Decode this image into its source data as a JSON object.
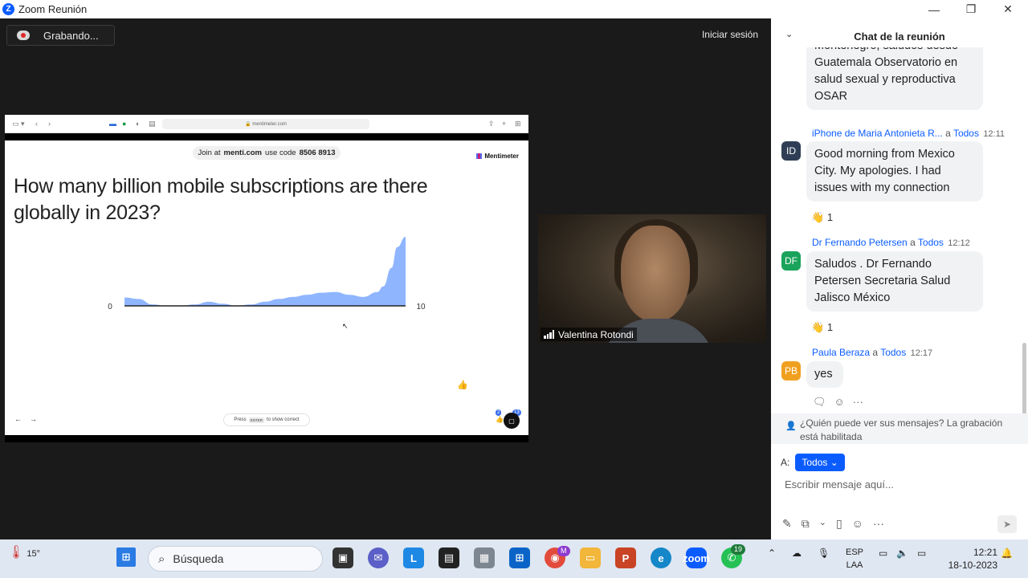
{
  "window": {
    "title": "Zoom Reunión",
    "logo_letter": "Z",
    "minimize_icon": "—",
    "maximize_icon": "❐",
    "close_icon": "✕"
  },
  "meeting": {
    "recording_label": "Grabando...",
    "signin_label": "Iniciar sesión"
  },
  "browser": {
    "url": "mentimeter.com"
  },
  "slide": {
    "join_prefix": "Join at",
    "join_site": "menti.com",
    "join_code_label": "use code",
    "join_code": "8506 8913",
    "brand": "Mentimeter",
    "question": "How many billion mobile subscriptions are there globally in 2023?",
    "press_text_before": "Press",
    "press_key": "ENTER",
    "press_text_after": "to show correct",
    "counter_badge_1": "2",
    "counter_badge_2": "13"
  },
  "chart_data": {
    "type": "area",
    "x_min_label": "0",
    "x_max_label": "10",
    "xlim": [
      0,
      10
    ],
    "x": [
      0,
      0.5,
      1,
      1.5,
      2,
      2.5,
      3,
      3.5,
      4,
      4.5,
      5,
      5.5,
      6,
      6.5,
      7,
      7.5,
      8,
      8.5,
      9,
      9.2,
      9.5,
      9.7,
      10
    ],
    "y": [
      0.12,
      0.1,
      0.02,
      0,
      0,
      0.02,
      0.06,
      0.03,
      0,
      0.02,
      0.06,
      0.1,
      0.13,
      0.16,
      0.19,
      0.2,
      0.16,
      0.13,
      0.2,
      0.28,
      0.55,
      0.85,
      1.0
    ]
  },
  "video": {
    "participant_name": "Valentina Rotondi"
  },
  "chat": {
    "title": "Chat de la reunión",
    "messages": [
      {
        "partial": true,
        "text": "Montenegro, saludos desde Guatemala Observatorio en salud sexual y reproductiva OSAR"
      },
      {
        "sender": "iPhone de Maria Antonieta R...",
        "to_word": "a",
        "to": "Todos",
        "time": "12:11",
        "initials": "ID",
        "avatar_color": "#2f3e55",
        "text": "Good morning from Mexico City. My apologies. I had issues with my connection",
        "reaction_emoji": "👋",
        "reaction_count": "1"
      },
      {
        "sender": "Dr Fernando Petersen",
        "to_word": "a",
        "to": "Todos",
        "time": "12:12",
        "initials": "DF",
        "avatar_color": "#1aa35a",
        "text": "Saludos . Dr Fernando Petersen Secretaria Salud Jalisco México",
        "reaction_emoji": "👋",
        "reaction_count": "1"
      },
      {
        "sender": "Paula Beraza",
        "to_word": "a",
        "to": "Todos",
        "time": "12:17",
        "initials": "PB",
        "avatar_color": "#f0a020",
        "text": "yes"
      }
    ],
    "privacy_text": "¿Quién puede ver sus mensajes? La grabación está habilitada",
    "to_label": "A:",
    "to_value": "Todos",
    "input_placeholder": "Escribir mensaje aquí..."
  },
  "taskbar": {
    "weather_temp": "15°",
    "search_label": "Búsqueda",
    "whatsapp_badge": "19",
    "chrome_badge": "M",
    "lang_line1": "ESP",
    "lang_line2": "LAA",
    "time": "12:21",
    "date": "18-10-2023"
  }
}
